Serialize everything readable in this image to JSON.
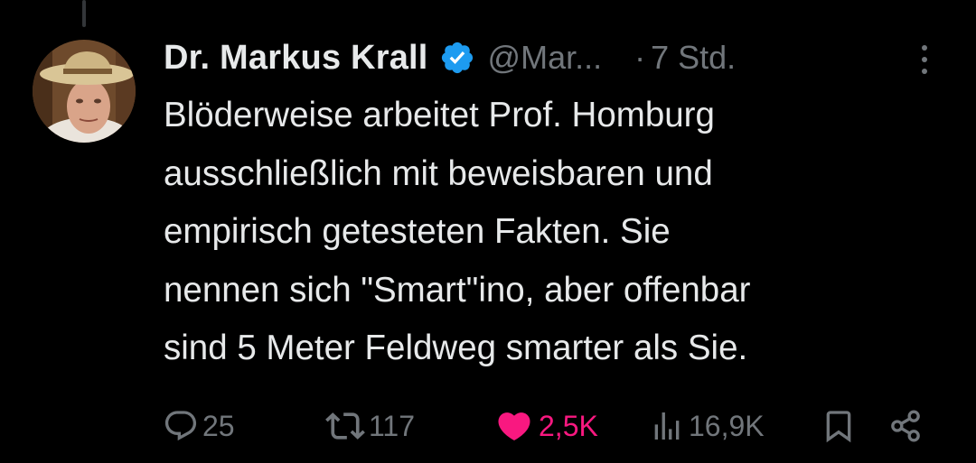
{
  "tweet": {
    "author": {
      "name": "Dr. Markus Krall",
      "handle": "@Mar...",
      "verified": true,
      "avatar": "avatar-photo"
    },
    "separator": "·",
    "time": "7 Std.",
    "text": "Blöderweise arbeitet Prof. Homburg\nausschließlich mit beweisbaren und\nempirisch getesteten Fakten. Sie\nnennen sich \"Smart\"ino, aber offenbar\nsind 5 Meter Feldweg smarter als Sie.",
    "actions": {
      "replies": {
        "icon": "reply-icon",
        "count": "25"
      },
      "reposts": {
        "icon": "repost-icon",
        "count": "117"
      },
      "likes": {
        "icon": "heart-icon",
        "count": "2,5K",
        "liked": true
      },
      "views": {
        "icon": "views-icon",
        "count": "16,9K"
      },
      "bookmark": {
        "icon": "bookmark-icon"
      },
      "share": {
        "icon": "share-icon"
      }
    }
  },
  "colors": {
    "background": "#000000",
    "text": "#e7e9ea",
    "secondary": "#71767b",
    "verified": "#1d9bf0",
    "like": "#f91880"
  }
}
